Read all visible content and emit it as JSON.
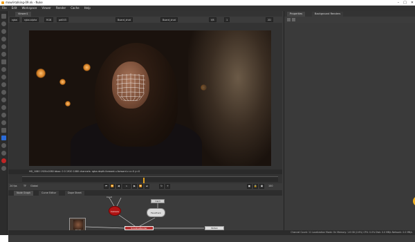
{
  "window": {
    "title": "mowli-talking-09.nk - Nuke"
  },
  "window_buttons": [
    "–",
    "□",
    "✕"
  ],
  "menubar": [
    "File",
    "Edit",
    "Workspace",
    "Viewer",
    "Render",
    "Cache",
    "Help"
  ],
  "viewer": {
    "tab": "Viewer1",
    "controls": {
      "channels": "rgba",
      "layer": "rgba.alpha",
      "colorspace": "RGB",
      "a_input": "A",
      "a_value": "pd003",
      "b_input": "B",
      "b_value": "Board_shot",
      "wipe_value": "0",
      "zoom": "f/8",
      "gain": "1",
      "view": "2D"
    },
    "format_label": "HD_1080",
    "info_line": "HD_1080 1920x1080  bbox: 0 0 1920 1080 channels: rgba.depth.forward.u.forward.v           x=0 y=0"
  },
  "timeline": {
    "fps": "24 fps",
    "mode": "TF",
    "frame_range_mode": "Global",
    "current_frame": "1",
    "end_frame": "100"
  },
  "node_tabs": [
    "Node Graph",
    "Curve Editor",
    "Dope Sheet"
  ],
  "right_panel": {
    "tabs": [
      "Properties",
      "Background Renders"
    ]
  },
  "nodes": {
    "camera": "Camera",
    "read": "Read1",
    "read_file": "mowli-talking.mov",
    "card": "Card",
    "facetrack": "FaceTrack",
    "scanline": "ScanlineRender",
    "write": "Write1",
    "input_label": "Input"
  },
  "status": "Channel Count: 11  Localization Mode: On  Memory: 1.6 GB (2.6%)  CPU: 0.0%  Disk: 0.0 MB/s  Network: 0.0 MB/s",
  "colors": {
    "accent": "#e0a020",
    "camera_node": "#b01515",
    "node_bg": "#3b3b3b"
  }
}
